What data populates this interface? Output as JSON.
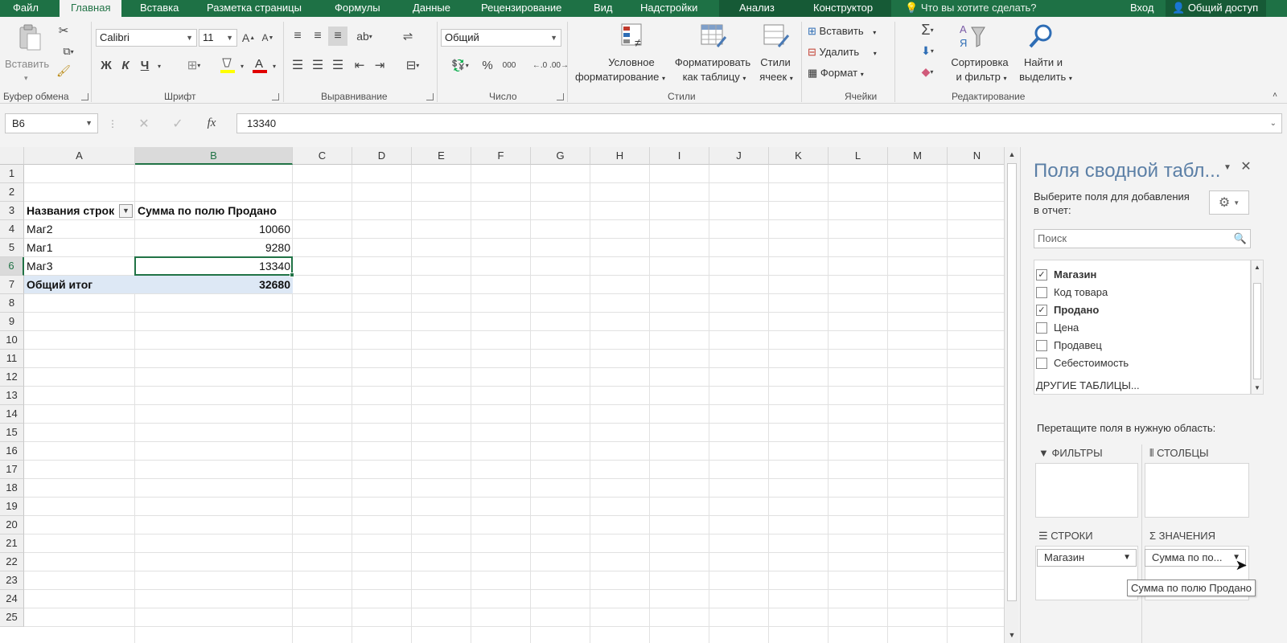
{
  "tabs": [
    "Файл",
    "Главная",
    "Вставка",
    "Разметка страницы",
    "Формулы",
    "Данные",
    "Рецензирование",
    "Вид",
    "Надстройки",
    "Анализ",
    "Конструктор"
  ],
  "tell_me": "Что вы хотите сделать?",
  "signin": "Вход",
  "share": "Общий доступ",
  "ribbon": {
    "clipboard": {
      "paste": "Вставить",
      "label": "Буфер обмена"
    },
    "font": {
      "name": "Calibri",
      "size": "11",
      "label": "Шрифт",
      "bold": "Ж",
      "italic": "К",
      "underline": "Ч"
    },
    "alignment": {
      "label": "Выравнивание"
    },
    "number": {
      "format": "Общий",
      "label": "Число",
      "percent": "%",
      "thousands": "000"
    },
    "styles": {
      "conditional_1": "Условное",
      "conditional_2": "форматирование",
      "as_table_1": "Форматировать",
      "as_table_2": "как таблицу",
      "cell_styles_1": "Стили",
      "cell_styles_2": "ячеек",
      "label": "Стили"
    },
    "cells": {
      "insert": "Вставить",
      "delete": "Удалить",
      "format": "Формат",
      "label": "Ячейки"
    },
    "editing": {
      "sort_1": "Сортировка",
      "sort_2": "и фильтр",
      "find_1": "Найти и",
      "find_2": "выделить",
      "label": "Редактирование"
    }
  },
  "formula_bar": {
    "name_box": "B6",
    "fx": "fx",
    "value": "13340"
  },
  "sheet": {
    "columns": [
      "A",
      "B",
      "C",
      "D",
      "E",
      "F",
      "G",
      "H",
      "I",
      "J",
      "K",
      "L",
      "M",
      "N"
    ],
    "rows": [
      "1",
      "2",
      "3",
      "4",
      "5",
      "6",
      "7",
      "8",
      "9",
      "10",
      "11",
      "12",
      "13",
      "14",
      "15",
      "16",
      "17",
      "18",
      "19",
      "20",
      "21",
      "22",
      "23",
      "24",
      "25"
    ],
    "header_a": "Названия строк",
    "header_b": "Сумма по полю Продано",
    "data": [
      {
        "label": "Маг2",
        "value": "10060"
      },
      {
        "label": "Маг1",
        "value": "9280"
      },
      {
        "label": "Маг3",
        "value": "13340"
      }
    ],
    "total_label": "Общий итог",
    "total_value": "32680",
    "accent": "#217346",
    "total_fill": "#dde8f5"
  },
  "pivot_pane": {
    "title": "Поля сводной табл...",
    "choose_1": "Выберите поля для добавления",
    "choose_2": "в отчет:",
    "search_placeholder": "Поиск",
    "fields": [
      {
        "name": "Магазин",
        "checked": "✓",
        "bold": true
      },
      {
        "name": "Код товара",
        "checked": "",
        "bold": false
      },
      {
        "name": "Продано",
        "checked": "✓",
        "bold": true
      },
      {
        "name": "Цена",
        "checked": "",
        "bold": false
      },
      {
        "name": "Продавец",
        "checked": "",
        "bold": false
      },
      {
        "name": "Себестоимость",
        "checked": "",
        "bold": false
      }
    ],
    "other_tables": "ДРУГИЕ ТАБЛИЦЫ...",
    "drag_hint": "Перетащите поля в нужную область:",
    "filters": "ФИЛЬТРЫ",
    "columns": "СТОЛБЦЫ",
    "rows": "СТРОКИ",
    "values": "ЗНАЧЕНИЯ",
    "rows_item": "Магазин",
    "values_item": "Сумма по по...",
    "tooltip": "Сумма по полю Продано"
  }
}
